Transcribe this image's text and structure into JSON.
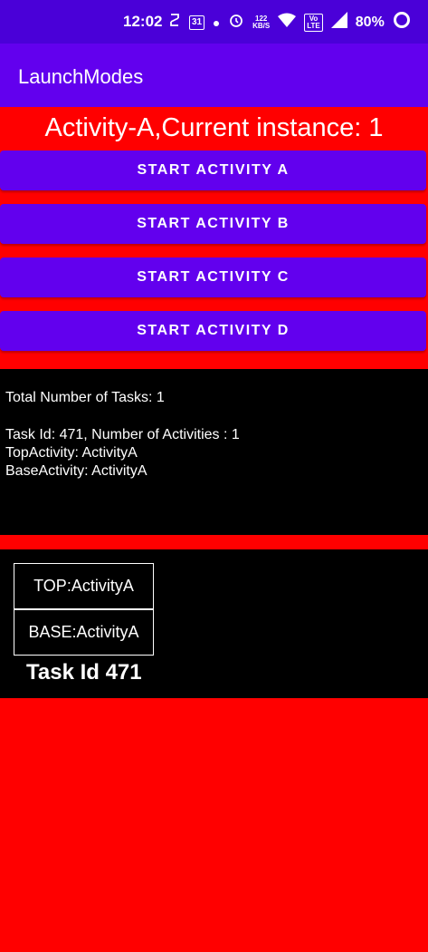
{
  "status_bar": {
    "time": "12:02",
    "icons": [
      "sync-icon",
      "calendar-icon",
      "dot-icon",
      "alarm-icon",
      "data-speed-icon",
      "wifi-icon",
      "volte-icon",
      "signal-icon",
      "battery-icon"
    ],
    "calendar_day": "31",
    "data_speed": "122",
    "data_speed_unit": "KB/S",
    "volte_top": "Vo",
    "volte_bottom": "LTE",
    "battery": "80%"
  },
  "app_bar": {
    "title": "LaunchModes"
  },
  "instance_text": "Activity-A,Current instance: 1",
  "buttons": {
    "a": "START ACTIVITY A",
    "b": "START ACTIVITY B",
    "c": "START ACTIVITY C",
    "d": "START ACTIVITY D"
  },
  "task_info": {
    "total": "Total Number of Tasks: 1",
    "task_line": "Task Id: 471, Number of Activities : 1",
    "top": "TopActivity: ActivityA",
    "base": "BaseActivity: ActivityA"
  },
  "stack": {
    "top": "TOP:ActivityA",
    "base": "BASE:ActivityA",
    "task_label": "Task Id 471"
  },
  "colors": {
    "background": "#ff0000",
    "primary": "#6200ee",
    "status_bar": "#4a00d8",
    "panel": "#000000"
  }
}
